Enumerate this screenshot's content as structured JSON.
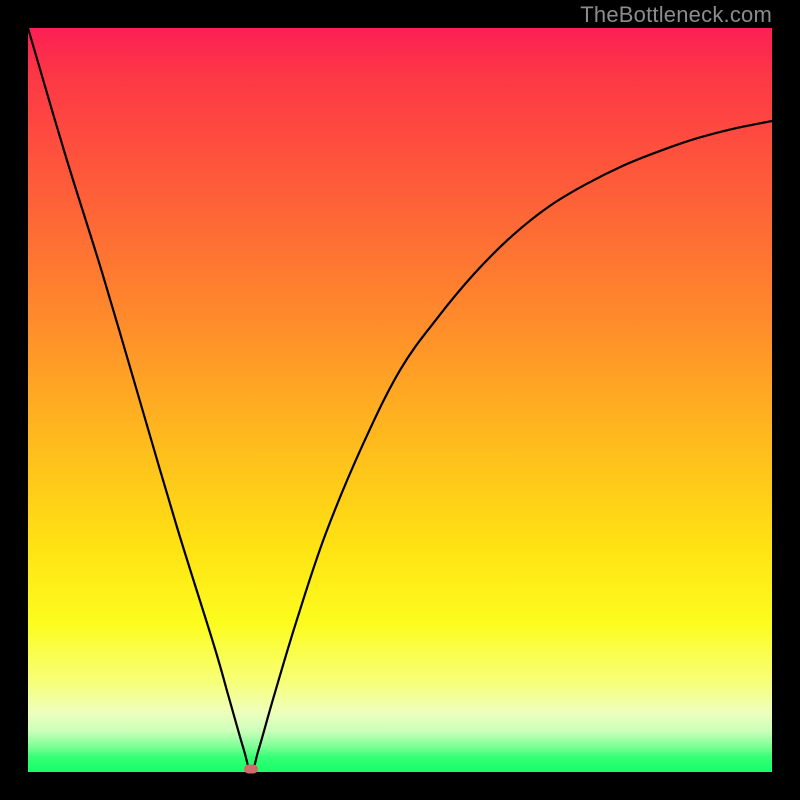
{
  "watermark": "TheBottleneck.com",
  "colors": {
    "page_bg": "#000000",
    "watermark": "#8c8c8c",
    "curve_stroke": "#000000",
    "marker_fill": "#cc6d6a"
  },
  "chart_data": {
    "type": "line",
    "title": "",
    "xlabel": "",
    "ylabel": "",
    "xlim": [
      0,
      100
    ],
    "ylim": [
      0,
      100
    ],
    "legend": false,
    "grid": false,
    "series": [
      {
        "name": "bottleneck-curve",
        "x": [
          0,
          5,
          10,
          15,
          20,
          25,
          27,
          29,
          30,
          31,
          33,
          36,
          40,
          45,
          50,
          55,
          60,
          65,
          70,
          75,
          80,
          85,
          90,
          95,
          100
        ],
        "y": [
          100,
          83,
          67,
          50,
          33,
          17,
          10,
          3,
          0,
          3,
          10,
          20,
          32,
          44,
          54,
          61,
          67,
          72,
          76,
          79,
          81.5,
          83.5,
          85.2,
          86.5,
          87.5
        ]
      }
    ],
    "annotations": [
      {
        "name": "min-marker",
        "x": 30,
        "y": 0,
        "shape": "rounded-rect",
        "color": "#cc6d6a"
      }
    ],
    "background_gradient": {
      "direction": "vertical",
      "stops": [
        {
          "pos": 0.0,
          "color": "#fc1f55"
        },
        {
          "pos": 0.4,
          "color": "#ff8d2b"
        },
        {
          "pos": 0.7,
          "color": "#ffe313"
        },
        {
          "pos": 0.92,
          "color": "#eeffbd"
        },
        {
          "pos": 1.0,
          "color": "#15ff68"
        }
      ]
    }
  }
}
